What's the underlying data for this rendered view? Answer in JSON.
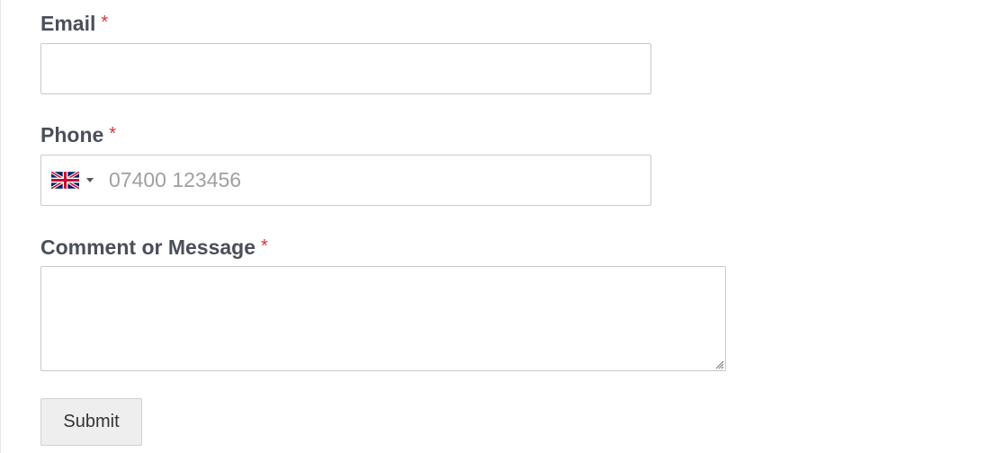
{
  "form": {
    "email": {
      "label": "Email",
      "required_mark": "*",
      "value": "",
      "placeholder": ""
    },
    "phone": {
      "label": "Phone",
      "required_mark": "*",
      "country_flag": "gb-flag-icon",
      "value": "",
      "placeholder": "07400 123456"
    },
    "message": {
      "label": "Comment or Message",
      "required_mark": "*",
      "value": ""
    },
    "submit_label": "Submit"
  },
  "colors": {
    "label_text": "#4a4f5a",
    "required_mark": "#d63638",
    "input_border": "#c9c9c9",
    "placeholder_text": "#a0a0a0",
    "button_background": "#eeeeee"
  }
}
